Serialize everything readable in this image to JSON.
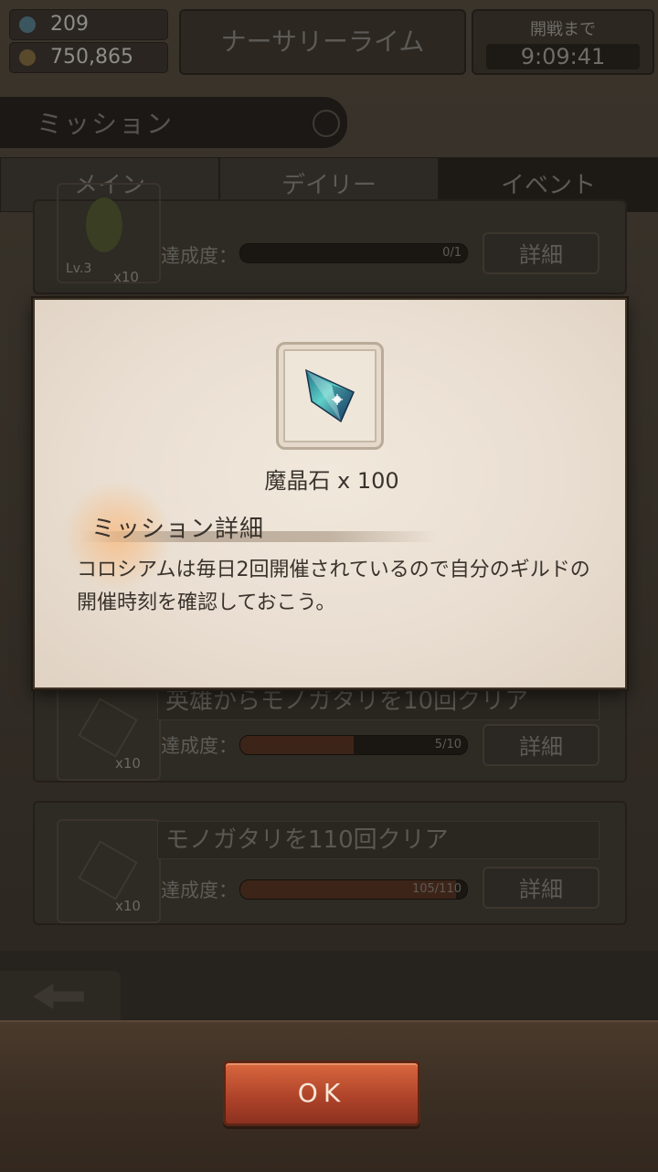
{
  "header": {
    "gems": "209",
    "gold": "750,865",
    "title": "ナーサリーライム",
    "timer_label": "開戦まで",
    "timer_value": "9:09:41"
  },
  "section_title": "ミッション",
  "tabs": [
    {
      "label": "メイン"
    },
    {
      "label": "デイリー"
    },
    {
      "label": "イベント"
    }
  ],
  "missions": [
    {
      "thumb_level": "Lv.3",
      "reward_count": "x10",
      "progress_label": "達成度：",
      "progress_text": "0/1",
      "progress": 0.0,
      "detail_label": "詳細"
    },
    {
      "title": "英雄からモノガタリを10回クリア",
      "reward_count": "x10",
      "progress_label": "達成度：",
      "progress_text": "5/10",
      "progress": 0.5,
      "detail_label": "詳細"
    },
    {
      "title": "モノガタリを110回クリア",
      "reward_count": "x10",
      "progress_label": "達成度：",
      "progress_text": "105/110",
      "progress": 0.95,
      "detail_label": "詳細"
    }
  ],
  "dialog": {
    "item_name": "魔晶石 x 100",
    "heading": "ミッション詳細",
    "body": "コロシアムは毎日2回開催されているので自分のギルドの開催時刻を確認しておこう。"
  },
  "ok_label": "OK",
  "colors": {
    "ok_button": "#b0442a",
    "dialog_bg": "#ece2d5",
    "crystal": "#5fd0c8"
  }
}
